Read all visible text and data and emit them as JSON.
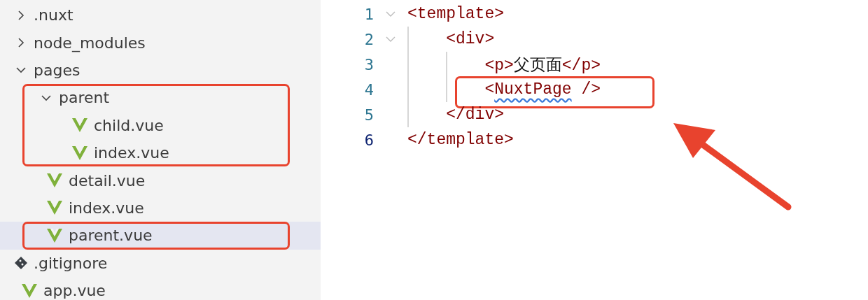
{
  "explorer": {
    "items": [
      {
        "name": ".nuxt",
        "kind": "folder",
        "expanded": false,
        "selected": false
      },
      {
        "name": "node_modules",
        "kind": "folder",
        "expanded": false,
        "selected": false
      },
      {
        "name": "pages",
        "kind": "folder",
        "expanded": true,
        "selected": false,
        "children": [
          {
            "name": "parent",
            "kind": "folder",
            "expanded": true,
            "selected": false,
            "highlighted": true,
            "children": [
              {
                "name": "child.vue",
                "kind": "vue",
                "selected": false
              },
              {
                "name": "index.vue",
                "kind": "vue",
                "selected": false
              }
            ]
          },
          {
            "name": "detail.vue",
            "kind": "vue",
            "selected": false
          },
          {
            "name": "index.vue",
            "kind": "vue",
            "selected": false
          },
          {
            "name": "parent.vue",
            "kind": "vue",
            "selected": true,
            "highlighted": true
          }
        ]
      },
      {
        "name": ".gitignore",
        "kind": "git",
        "selected": false
      },
      {
        "name": "app.vue",
        "kind": "vue",
        "selected": false
      }
    ]
  },
  "editor": {
    "lines": [
      {
        "number": "1",
        "foldable": true,
        "active": false,
        "tokens": [
          {
            "text": "<template>",
            "kind": "tag"
          }
        ]
      },
      {
        "number": "2",
        "foldable": true,
        "active": false,
        "tokens": [
          {
            "text": "    <div>",
            "kind": "tag"
          }
        ]
      },
      {
        "number": "3",
        "active": false,
        "tokens": [
          {
            "text": "        <p>",
            "kind": "tag"
          },
          {
            "text": "父页面",
            "kind": "text"
          },
          {
            "text": "</p>",
            "kind": "tag"
          }
        ]
      },
      {
        "number": "4",
        "active": false,
        "highlighted": true,
        "tokens": [
          {
            "text": "        <",
            "kind": "tag"
          },
          {
            "text": "NuxtPage",
            "kind": "tag",
            "squiggle": true
          },
          {
            "text": " />",
            "kind": "tag"
          }
        ]
      },
      {
        "number": "5",
        "active": false,
        "tokens": [
          {
            "text": "    </div>",
            "kind": "tag"
          }
        ]
      },
      {
        "number": "6",
        "active": true,
        "tokens": [
          {
            "text": "</template>",
            "kind": "tag"
          }
        ]
      }
    ],
    "arrow": true
  }
}
